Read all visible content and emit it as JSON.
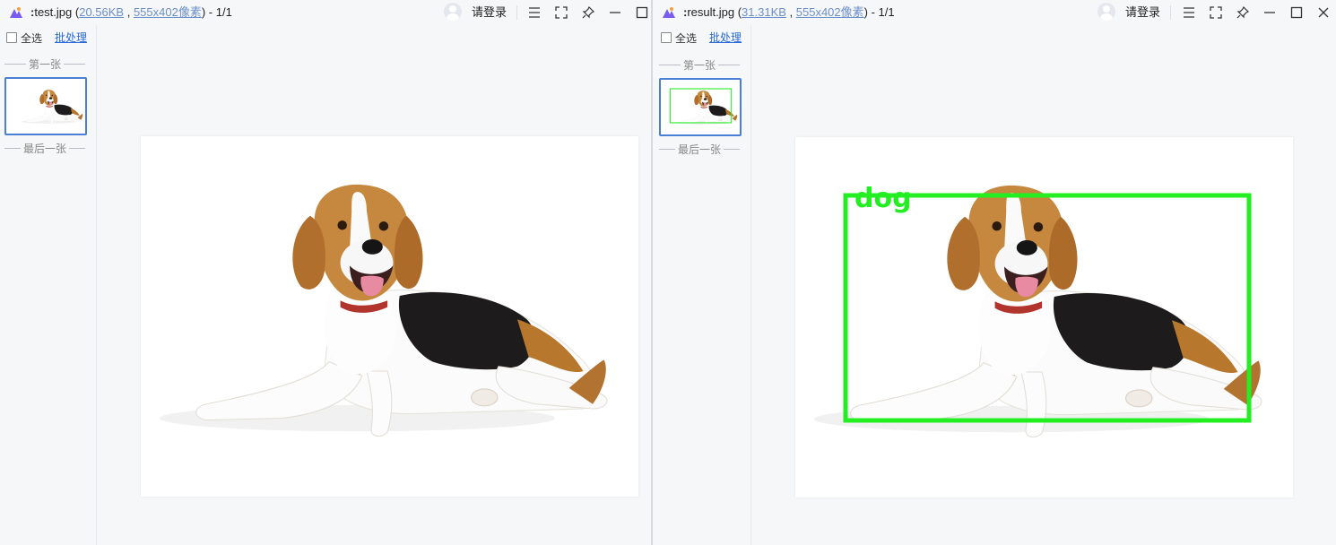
{
  "left": {
    "filename": "test.jpg",
    "filesize": "20.56KB",
    "dimensions": "555x402像素",
    "page": " - 1/1",
    "login": "请登录",
    "select_all": "全选",
    "batch": "批处理",
    "first_label": "第一张",
    "last_label": "最后一张"
  },
  "right": {
    "filename": "result.jpg",
    "filesize": "31.31KB",
    "dimensions": "555x402像素",
    "page": " - 1/1",
    "login": "请登录",
    "select_all": "全选",
    "batch": "批处理",
    "first_label": "第一张",
    "last_label": "最后一张",
    "detection": {
      "label": "dog",
      "color": "#22ee22"
    }
  },
  "icons": [
    "app-logo-icon",
    "menu-icon",
    "fullscreen-icon",
    "pin-icon",
    "minimize-icon",
    "maximize-icon",
    "close-icon"
  ],
  "colors": {
    "accent": "#4a7fd6",
    "link": "#2a6ad8",
    "detection_box": "#22ee22"
  }
}
